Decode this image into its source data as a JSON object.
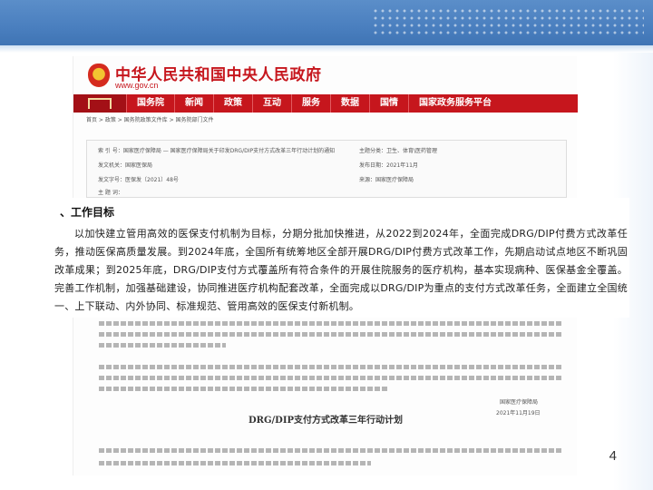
{
  "slide": {
    "page_number": "4"
  },
  "site": {
    "title": "中华人民共和国中央人民政府",
    "url": "www.gov.cn",
    "nav": [
      "国务院",
      "新闻",
      "政策",
      "互动",
      "服务",
      "数据",
      "国情",
      "国家政务服务平台"
    ],
    "breadcrumb": "首页 > 政策 > 国务院政策文件库 > 国务院部门文件"
  },
  "meta": {
    "index_label": "索 引 号：",
    "index_value": "国家医疗保障局 — 国家医疗保障局关于印发DRG/DIP支付方式改革三年行动计划的通知",
    "topic_label": "主题分类：",
    "topic_value": "卫生、体育\\医药管理",
    "issuer_label": "发文机关：",
    "issuer_value": "国家医保局",
    "doc_no_label": "发文字号：",
    "doc_no_value": "医保发〔2021〕48号",
    "date_label": "发布日期：",
    "date_value": "2021年11月",
    "subject_label": "主 题 词：",
    "subject_value": "",
    "source_label": "来源：",
    "source_value": "国家医疗保障局"
  },
  "article": {
    "signature_org": "国家医疗保障局",
    "signature_date": "2021年11月19日",
    "doc_title": "DRG/DIP支付方式改革三年行动计划"
  },
  "overlay": {
    "section_title": "、工作目标",
    "paragraph": "以加快建立管用高效的医保支付机制为目标，分期分批加快推进，从2022到2024年，全面完成DRG/DIP付费方式改革任务，推动医保高质量发展。到2024年底，全国所有统筹地区全部开展DRG/DIP付费方式改革工作，先期启动试点地区不断巩固改革成果；到2025年底，DRG/DIP支付方式覆盖所有符合条件的开展住院服务的医疗机构，基本实现病种、医保基金全覆盖。完善工作机制，加强基础建设，协同推进医疗机构配套改革，全面完成以DRG/DIP为重点的支付方式改革任务，全面建立全国统一、上下联动、内外协同、标准规范、管用高效的医保支付新机制。"
  }
}
